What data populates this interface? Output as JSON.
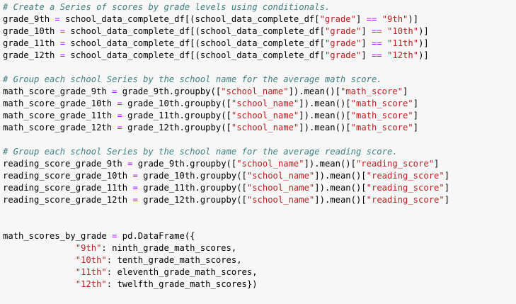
{
  "code_lines": [
    [
      {
        "t": "# Create a Series of scores by grade levels using conditionals.",
        "k": "c"
      }
    ],
    [
      {
        "t": "grade_9th ",
        "k": "n"
      },
      {
        "t": "=",
        "k": "o"
      },
      {
        "t": " school_data_complete_df[(school_data_complete_df[",
        "k": "n"
      },
      {
        "t": "\"grade\"",
        "k": "s"
      },
      {
        "t": "] ",
        "k": "n"
      },
      {
        "t": "==",
        "k": "o"
      },
      {
        "t": " ",
        "k": "n"
      },
      {
        "t": "\"9th\"",
        "k": "s"
      },
      {
        "t": ")]",
        "k": "n"
      }
    ],
    [
      {
        "t": "grade_10th ",
        "k": "n"
      },
      {
        "t": "=",
        "k": "o"
      },
      {
        "t": " school_data_complete_df[(school_data_complete_df[",
        "k": "n"
      },
      {
        "t": "\"grade\"",
        "k": "s"
      },
      {
        "t": "] ",
        "k": "n"
      },
      {
        "t": "==",
        "k": "o"
      },
      {
        "t": " ",
        "k": "n"
      },
      {
        "t": "\"10th\"",
        "k": "s"
      },
      {
        "t": ")]",
        "k": "n"
      }
    ],
    [
      {
        "t": "grade_11th ",
        "k": "n"
      },
      {
        "t": "=",
        "k": "o"
      },
      {
        "t": " school_data_complete_df[(school_data_complete_df[",
        "k": "n"
      },
      {
        "t": "\"grade\"",
        "k": "s"
      },
      {
        "t": "] ",
        "k": "n"
      },
      {
        "t": "==",
        "k": "o"
      },
      {
        "t": " ",
        "k": "n"
      },
      {
        "t": "\"11th\"",
        "k": "s"
      },
      {
        "t": ")]",
        "k": "n"
      }
    ],
    [
      {
        "t": "grade_12th ",
        "k": "n"
      },
      {
        "t": "=",
        "k": "o"
      },
      {
        "t": " school_data_complete_df[(school_data_complete_df[",
        "k": "n"
      },
      {
        "t": "\"grade\"",
        "k": "s"
      },
      {
        "t": "] ",
        "k": "n"
      },
      {
        "t": "==",
        "k": "o"
      },
      {
        "t": " ",
        "k": "n"
      },
      {
        "t": "\"12th\"",
        "k": "s"
      },
      {
        "t": ")]",
        "k": "n"
      }
    ],
    [],
    [
      {
        "t": "# Group each school Series by the school name for the average math score.",
        "k": "c"
      }
    ],
    [
      {
        "t": "math_score_grade_9th ",
        "k": "n"
      },
      {
        "t": "=",
        "k": "o"
      },
      {
        "t": " grade_9th.groupby([",
        "k": "n"
      },
      {
        "t": "\"school_name\"",
        "k": "s"
      },
      {
        "t": "]).mean()[",
        "k": "n"
      },
      {
        "t": "\"math_score\"",
        "k": "s"
      },
      {
        "t": "]",
        "k": "n"
      }
    ],
    [
      {
        "t": "math_score_grade_10th ",
        "k": "n"
      },
      {
        "t": "=",
        "k": "o"
      },
      {
        "t": " grade_10th.groupby([",
        "k": "n"
      },
      {
        "t": "\"school_name\"",
        "k": "s"
      },
      {
        "t": "]).mean()[",
        "k": "n"
      },
      {
        "t": "\"math_score\"",
        "k": "s"
      },
      {
        "t": "]",
        "k": "n"
      }
    ],
    [
      {
        "t": "math_score_grade_11th ",
        "k": "n"
      },
      {
        "t": "=",
        "k": "o"
      },
      {
        "t": " grade_11th.groupby([",
        "k": "n"
      },
      {
        "t": "\"school_name\"",
        "k": "s"
      },
      {
        "t": "]).mean()[",
        "k": "n"
      },
      {
        "t": "\"math_score\"",
        "k": "s"
      },
      {
        "t": "]",
        "k": "n"
      }
    ],
    [
      {
        "t": "math_score_grade_12th ",
        "k": "n"
      },
      {
        "t": "=",
        "k": "o"
      },
      {
        "t": " grade_12th.groupby([",
        "k": "n"
      },
      {
        "t": "\"school_name\"",
        "k": "s"
      },
      {
        "t": "]).mean()[",
        "k": "n"
      },
      {
        "t": "\"math_score\"",
        "k": "s"
      },
      {
        "t": "]",
        "k": "n"
      }
    ],
    [],
    [
      {
        "t": "# Group each school Series by the school name for the average reading score.",
        "k": "c"
      }
    ],
    [
      {
        "t": "reading_score_grade_9th ",
        "k": "n"
      },
      {
        "t": "=",
        "k": "o"
      },
      {
        "t": " grade_9th.groupby([",
        "k": "n"
      },
      {
        "t": "\"school_name\"",
        "k": "s"
      },
      {
        "t": "]).mean()[",
        "k": "n"
      },
      {
        "t": "\"reading_score\"",
        "k": "s"
      },
      {
        "t": "]",
        "k": "n"
      }
    ],
    [
      {
        "t": "reading_score_grade_10th ",
        "k": "n"
      },
      {
        "t": "=",
        "k": "o"
      },
      {
        "t": " grade_10th.groupby([",
        "k": "n"
      },
      {
        "t": "\"school_name\"",
        "k": "s"
      },
      {
        "t": "]).mean()[",
        "k": "n"
      },
      {
        "t": "\"reading_score\"",
        "k": "s"
      },
      {
        "t": "]",
        "k": "n"
      }
    ],
    [
      {
        "t": "reading_score_grade_11th ",
        "k": "n"
      },
      {
        "t": "=",
        "k": "o"
      },
      {
        "t": " grade_11th.groupby([",
        "k": "n"
      },
      {
        "t": "\"school_name\"",
        "k": "s"
      },
      {
        "t": "]).mean()[",
        "k": "n"
      },
      {
        "t": "\"reading_score\"",
        "k": "s"
      },
      {
        "t": "]",
        "k": "n"
      }
    ],
    [
      {
        "t": "reading_score_grade_12th ",
        "k": "n"
      },
      {
        "t": "=",
        "k": "o"
      },
      {
        "t": " grade_12th.groupby([",
        "k": "n"
      },
      {
        "t": "\"school_name\"",
        "k": "s"
      },
      {
        "t": "]).mean()[",
        "k": "n"
      },
      {
        "t": "\"reading_score\"",
        "k": "s"
      },
      {
        "t": "]",
        "k": "n"
      }
    ],
    [],
    [],
    [
      {
        "t": "math_scores_by_grade ",
        "k": "n"
      },
      {
        "t": "=",
        "k": "o"
      },
      {
        "t": " pd.DataFrame({",
        "k": "n"
      }
    ],
    [
      {
        "t": "              ",
        "k": "n"
      },
      {
        "t": "\"9th\"",
        "k": "s"
      },
      {
        "t": ": ninth_grade_math_scores,",
        "k": "n"
      }
    ],
    [
      {
        "t": "              ",
        "k": "n"
      },
      {
        "t": "\"10th\"",
        "k": "s"
      },
      {
        "t": ": tenth_grade_math_scores,",
        "k": "n"
      }
    ],
    [
      {
        "t": "              ",
        "k": "n"
      },
      {
        "t": "\"11th\"",
        "k": "s"
      },
      {
        "t": ": eleventh_grade_math_scores,",
        "k": "n"
      }
    ],
    [
      {
        "t": "              ",
        "k": "n"
      },
      {
        "t": "\"12th\"",
        "k": "s"
      },
      {
        "t": ": twelfth_grade_math_scores})",
        "k": "n"
      }
    ]
  ],
  "colors": {
    "comment": "#408080",
    "operator": "#aa22ff",
    "string": "#ba2121",
    "default": "#000000",
    "background": "#f7f7f7"
  }
}
